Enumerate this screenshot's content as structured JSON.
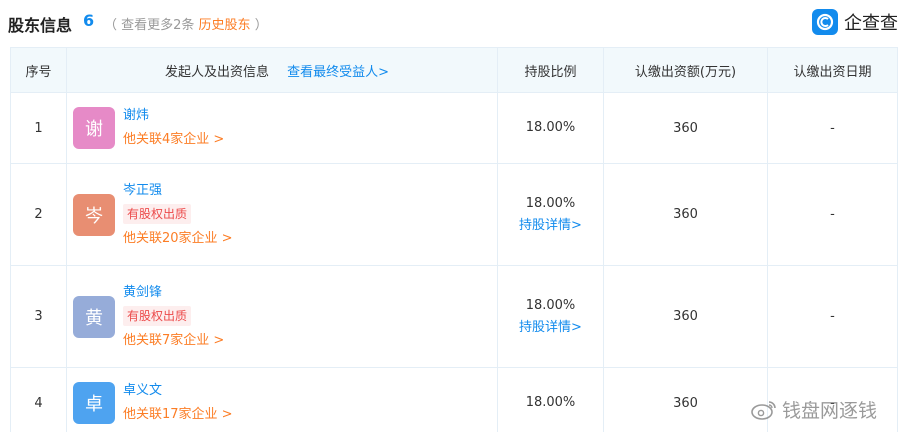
{
  "header": {
    "title": "股东信息",
    "count": "6",
    "sub_prefix": "（ 查看更多2条",
    "sub_link": "历史股东",
    "sub_suffix": "）"
  },
  "logo": {
    "text": "企查查"
  },
  "table": {
    "columns": {
      "index": "序号",
      "holder": "发起人及出资信息",
      "holder_link": "查看最终受益人>",
      "ratio": "持股比例",
      "amount": "认缴出资额(万元)",
      "date": "认缴出资日期"
    },
    "rows": [
      {
        "index": "1",
        "avatar": "谢",
        "avatar_color": "#e68ac7",
        "name": "谢炜",
        "tag": "",
        "related": "他关联4家企业 >",
        "ratio": "18.00%",
        "detail": "",
        "amount": "360",
        "date": "-"
      },
      {
        "index": "2",
        "avatar": "岑",
        "avatar_color": "#e88e72",
        "name": "岑正强",
        "tag": "有股权出质",
        "related": "他关联20家企业 >",
        "ratio": "18.00%",
        "detail": "持股详情>",
        "amount": "360",
        "date": "-"
      },
      {
        "index": "3",
        "avatar": "黄",
        "avatar_color": "#96acd9",
        "name": "黄剑锋",
        "tag": "有股权出质",
        "related": "他关联7家企业 >",
        "ratio": "18.00%",
        "detail": "持股详情>",
        "amount": "360",
        "date": "-"
      },
      {
        "index": "4",
        "avatar": "卓",
        "avatar_color": "#4ea3f0",
        "name": "卓义文",
        "tag": "",
        "related": "他关联17家企业 >",
        "ratio": "18.00%",
        "detail": "",
        "amount": "360",
        "date": "-"
      }
    ]
  },
  "watermark": {
    "text": "钱盘网逐钱"
  }
}
